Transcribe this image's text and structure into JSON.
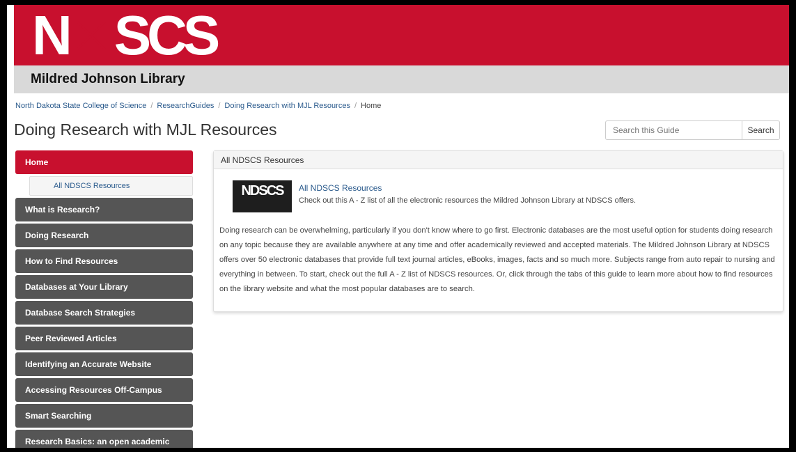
{
  "header": {
    "logo_text": "NDSCS",
    "library_name": "Mildred Johnson Library",
    "brand_color": "#c8102e"
  },
  "breadcrumb": [
    "North Dakota State College of Science",
    "ResearchGuides",
    "Doing Research with MJL Resources",
    "Home"
  ],
  "page_title": "Doing Research with MJL Resources",
  "search": {
    "placeholder": "Search this Guide",
    "button_label": "Search"
  },
  "sidenav": {
    "active": "Home",
    "sub_item": "All NDSCS Resources",
    "items": [
      "What is Research?",
      "Doing Research",
      "How to Find Resources",
      "Databases at Your Library",
      "Database Search Strategies",
      "Peer Reviewed Articles",
      "Identifying an Accurate Website",
      "Accessing Resources Off-Campus",
      "Smart Searching",
      "Research Basics: an open academic research skills course"
    ]
  },
  "panel": {
    "heading": "All NDSCS Resources",
    "resource_thumb": "NDSCS",
    "resource_title": "All NDSCS Resources",
    "resource_description": "Check out this A - Z list of all the electronic resources the Mildred Johnson Library at NDSCS offers.",
    "body": "Doing research can be overwhelming, particularly if you don't know where to go first. Electronic databases are the most useful option for students doing research on any topic because they are available anywhere at any time and offer academically reviewed and accepted materials. The Mildred Johnson Library at NDSCS offers over 50 electronic databases that provide full text journal articles, eBooks, images, facts and so much more. Subjects range from auto repair to nursing and everything in between. To start, check out the full A - Z list of NDSCS resources. Or, click through the tabs of this guide to learn more about how to find resources on the library website and what the most popular databases are to search."
  }
}
